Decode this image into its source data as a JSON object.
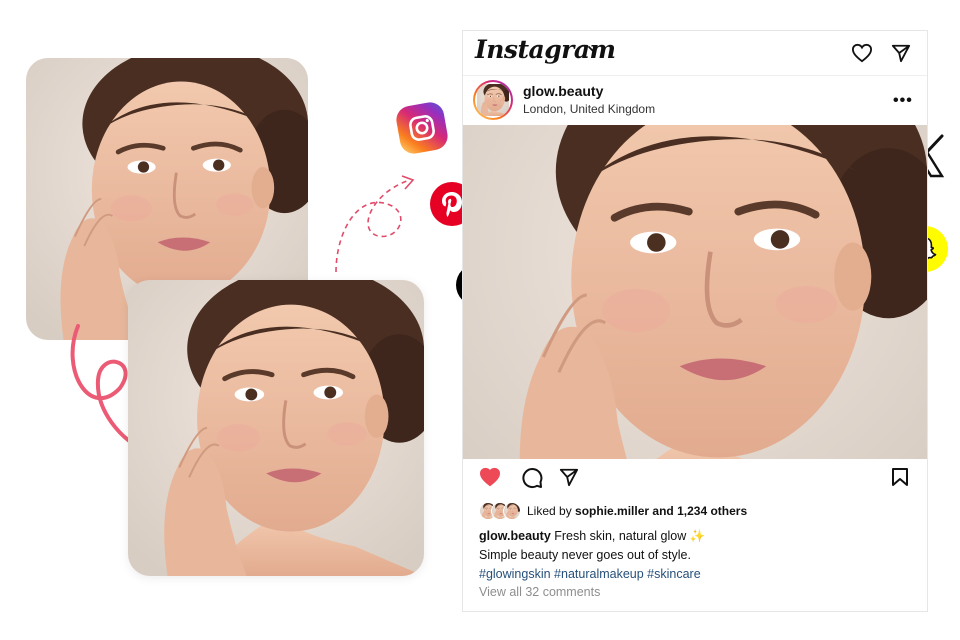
{
  "app": {
    "name": "Instagram"
  },
  "post": {
    "username": "glow.beauty",
    "location": "London, United Kingdom",
    "more_label": "•••",
    "liked_by_prefix": "Liked by",
    "liked_by_user": "sophie.miller",
    "liked_by_suffix": "and 1,234 others",
    "caption_user": "glow.beauty",
    "caption_text": "Fresh skin, natural glow ✨",
    "caption_line2": "Simple beauty never goes out of style.",
    "hashtags": "#glowingskin #naturalmakeup #skincare",
    "comments_link": "View all 32 comments",
    "liked": true
  },
  "icons": {
    "header": [
      "chevron-down-icon",
      "heart-icon",
      "send-icon"
    ],
    "actions": [
      "heart-icon",
      "comment-icon",
      "share-icon",
      "bookmark-icon"
    ],
    "social": [
      "instagram-logo",
      "pinterest-logo",
      "tiktok-logo",
      "x-logo",
      "snapchat-logo"
    ]
  },
  "colors": {
    "like_red": "#ed4956",
    "hashtag_blue": "#27507a",
    "arrow_pink": "#ec5b75",
    "pinterest_red": "#e60023",
    "snapchat_yellow": "#fffc00"
  }
}
